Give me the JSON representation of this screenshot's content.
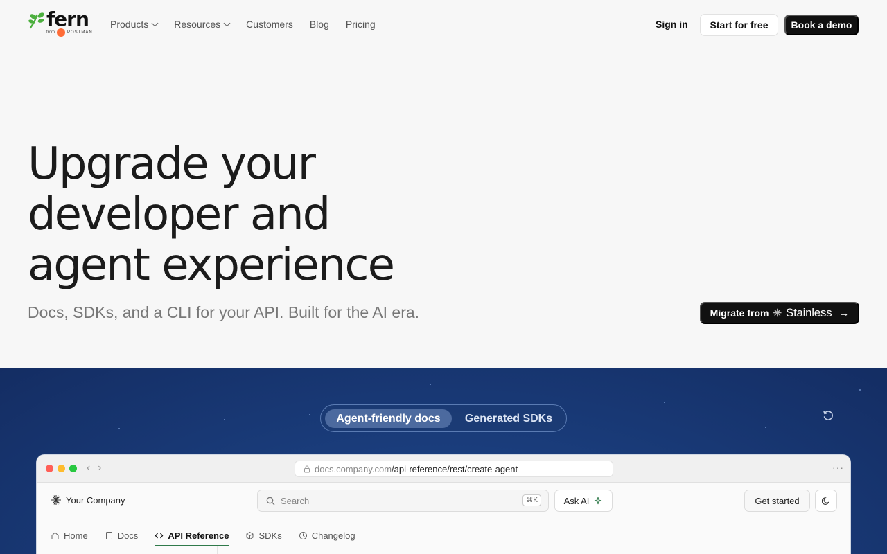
{
  "nav": {
    "logo_text": "fern",
    "logo_from": "from",
    "logo_partner": "POSTMAN",
    "links": [
      {
        "label": "Products",
        "dropdown": true
      },
      {
        "label": "Resources",
        "dropdown": true
      },
      {
        "label": "Customers",
        "dropdown": false
      },
      {
        "label": "Blog",
        "dropdown": false
      },
      {
        "label": "Pricing",
        "dropdown": false
      }
    ],
    "sign_in": "Sign in",
    "start_free": "Start for free",
    "book_demo": "Book a demo"
  },
  "hero": {
    "title_lines": [
      "Upgrade your",
      "developer and",
      "agent experience"
    ],
    "subtitle": "Docs, SDKs, and a CLI for your API. Built for the AI era.",
    "migrate_prefix": "Migrate from",
    "migrate_target": "Stainless"
  },
  "showcase": {
    "tabs": [
      "Agent-friendly docs",
      "Generated SDKs"
    ],
    "active_tab": "Agent-friendly docs",
    "browser": {
      "url_host": "docs.company.com",
      "url_path": "/api-reference/rest/create-agent",
      "brand": "Your Company",
      "search_placeholder": "Search",
      "search_shortcut": "⌘K",
      "ask_ai": "Ask AI",
      "get_started": "Get started",
      "tabs": [
        {
          "label": "Home",
          "icon": "home-icon"
        },
        {
          "label": "Docs",
          "icon": "book-icon"
        },
        {
          "label": "API Reference",
          "icon": "code-icon",
          "active": true
        },
        {
          "label": "SDKs",
          "icon": "cube-icon"
        },
        {
          "label": "Changelog",
          "icon": "clock-icon"
        }
      ]
    }
  },
  "colors": {
    "brand_green": "#4caf3e",
    "postman_orange": "#ff6c37",
    "dark_button": "#111111",
    "section_blue": "#1a3d7c",
    "active_tab_underline": "#2f7a4a"
  }
}
